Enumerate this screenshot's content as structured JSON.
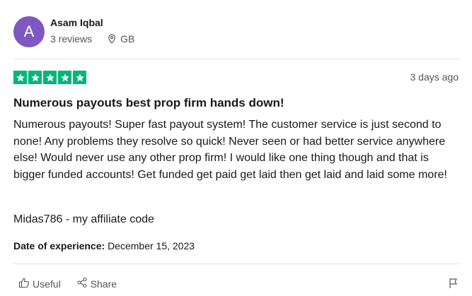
{
  "reviewer": {
    "initial": "A",
    "name": "Asam Iqbal",
    "reviews": "3 reviews",
    "country": "GB",
    "avatar_color": "#7e57c2"
  },
  "review": {
    "rating": 5,
    "star_color": "#00b67a",
    "date_ago": "3 days ago",
    "title": "Numerous payouts best prop firm hands down!",
    "body": "Numerous payouts! Super fast payout system! The customer service is just second to none! Any problems they resolve so quick! Never seen or had better service anywhere else! Would never use any other prop firm! I would like one thing though and that is bigger funded accounts! Get funded get paid get laid then get laid and laid some more!",
    "affiliate": "Midas786 - my affiliate code",
    "experience_label": "Date of experience:",
    "experience_date": "December 15, 2023"
  },
  "actions": {
    "useful": "Useful",
    "share": "Share",
    "icons": [
      "thumbs-up-icon",
      "share-icon",
      "flag-icon"
    ]
  }
}
